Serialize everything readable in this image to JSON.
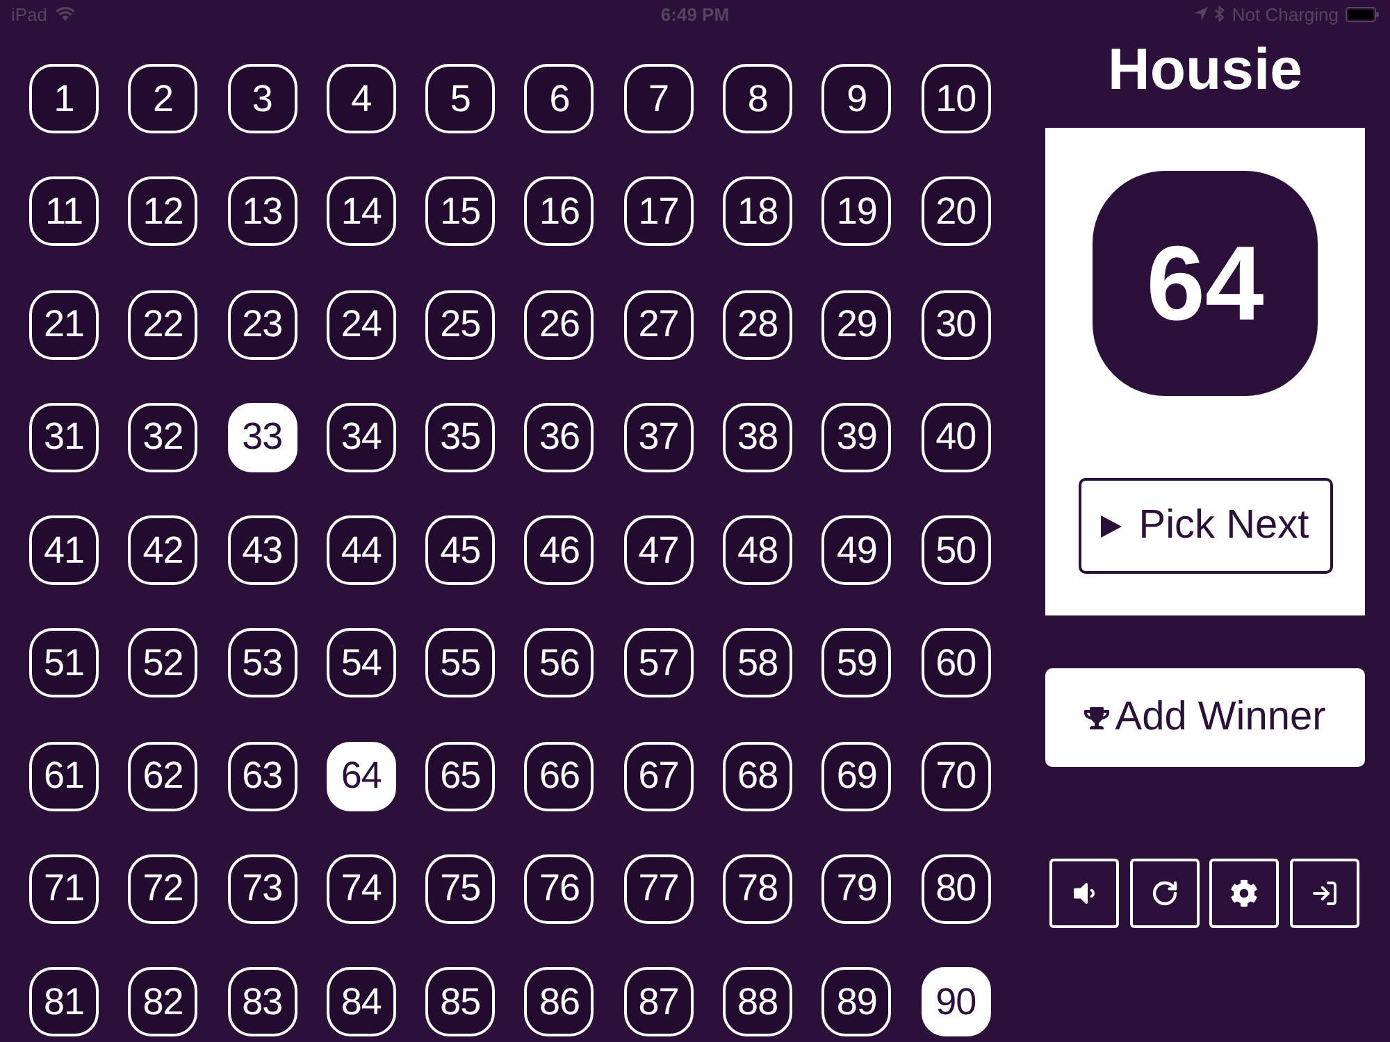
{
  "status_bar": {
    "carrier": "iPad",
    "time": "6:49 PM",
    "charging": "Not Charging"
  },
  "board": {
    "numbers": [
      {
        "label": "1",
        "called": false
      },
      {
        "label": "2",
        "called": false
      },
      {
        "label": "3",
        "called": false
      },
      {
        "label": "4",
        "called": false
      },
      {
        "label": "5",
        "called": false
      },
      {
        "label": "6",
        "called": false
      },
      {
        "label": "7",
        "called": false
      },
      {
        "label": "8",
        "called": false
      },
      {
        "label": "9",
        "called": false
      },
      {
        "label": "10",
        "called": false
      },
      {
        "label": "11",
        "called": false
      },
      {
        "label": "12",
        "called": false
      },
      {
        "label": "13",
        "called": false
      },
      {
        "label": "14",
        "called": false
      },
      {
        "label": "15",
        "called": false
      },
      {
        "label": "16",
        "called": false
      },
      {
        "label": "17",
        "called": false
      },
      {
        "label": "18",
        "called": false
      },
      {
        "label": "19",
        "called": false
      },
      {
        "label": "20",
        "called": false
      },
      {
        "label": "21",
        "called": false
      },
      {
        "label": "22",
        "called": false
      },
      {
        "label": "23",
        "called": false
      },
      {
        "label": "24",
        "called": false
      },
      {
        "label": "25",
        "called": false
      },
      {
        "label": "26",
        "called": false
      },
      {
        "label": "27",
        "called": false
      },
      {
        "label": "28",
        "called": false
      },
      {
        "label": "29",
        "called": false
      },
      {
        "label": "30",
        "called": false
      },
      {
        "label": "31",
        "called": false
      },
      {
        "label": "32",
        "called": false
      },
      {
        "label": "33",
        "called": true
      },
      {
        "label": "34",
        "called": false
      },
      {
        "label": "35",
        "called": false
      },
      {
        "label": "36",
        "called": false
      },
      {
        "label": "37",
        "called": false
      },
      {
        "label": "38",
        "called": false
      },
      {
        "label": "39",
        "called": false
      },
      {
        "label": "40",
        "called": false
      },
      {
        "label": "41",
        "called": false
      },
      {
        "label": "42",
        "called": false
      },
      {
        "label": "43",
        "called": false
      },
      {
        "label": "44",
        "called": false
      },
      {
        "label": "45",
        "called": false
      },
      {
        "label": "46",
        "called": false
      },
      {
        "label": "47",
        "called": false
      },
      {
        "label": "48",
        "called": false
      },
      {
        "label": "49",
        "called": false
      },
      {
        "label": "50",
        "called": false
      },
      {
        "label": "51",
        "called": false
      },
      {
        "label": "52",
        "called": false
      },
      {
        "label": "53",
        "called": false
      },
      {
        "label": "54",
        "called": false
      },
      {
        "label": "55",
        "called": false
      },
      {
        "label": "56",
        "called": false
      },
      {
        "label": "57",
        "called": false
      },
      {
        "label": "58",
        "called": false
      },
      {
        "label": "59",
        "called": false
      },
      {
        "label": "60",
        "called": false
      },
      {
        "label": "61",
        "called": false
      },
      {
        "label": "62",
        "called": false
      },
      {
        "label": "63",
        "called": false
      },
      {
        "label": "64",
        "called": true
      },
      {
        "label": "65",
        "called": false
      },
      {
        "label": "66",
        "called": false
      },
      {
        "label": "67",
        "called": false
      },
      {
        "label": "68",
        "called": false
      },
      {
        "label": "69",
        "called": false
      },
      {
        "label": "70",
        "called": false
      },
      {
        "label": "71",
        "called": false
      },
      {
        "label": "72",
        "called": false
      },
      {
        "label": "73",
        "called": false
      },
      {
        "label": "74",
        "called": false
      },
      {
        "label": "75",
        "called": false
      },
      {
        "label": "76",
        "called": false
      },
      {
        "label": "77",
        "called": false
      },
      {
        "label": "78",
        "called": false
      },
      {
        "label": "79",
        "called": false
      },
      {
        "label": "80",
        "called": false
      },
      {
        "label": "81",
        "called": false
      },
      {
        "label": "82",
        "called": false
      },
      {
        "label": "83",
        "called": false
      },
      {
        "label": "84",
        "called": false
      },
      {
        "label": "85",
        "called": false
      },
      {
        "label": "86",
        "called": false
      },
      {
        "label": "87",
        "called": false
      },
      {
        "label": "88",
        "called": false
      },
      {
        "label": "89",
        "called": false
      },
      {
        "label": "90",
        "called": true
      }
    ]
  },
  "panel": {
    "title": "Housie",
    "current_number": "64",
    "pick_button": "Pick Next"
  },
  "winner_button": "Add Winner",
  "toolbar": [
    {
      "kind": "sound"
    },
    {
      "kind": "refresh"
    },
    {
      "kind": "settings"
    },
    {
      "kind": "login"
    }
  ]
}
